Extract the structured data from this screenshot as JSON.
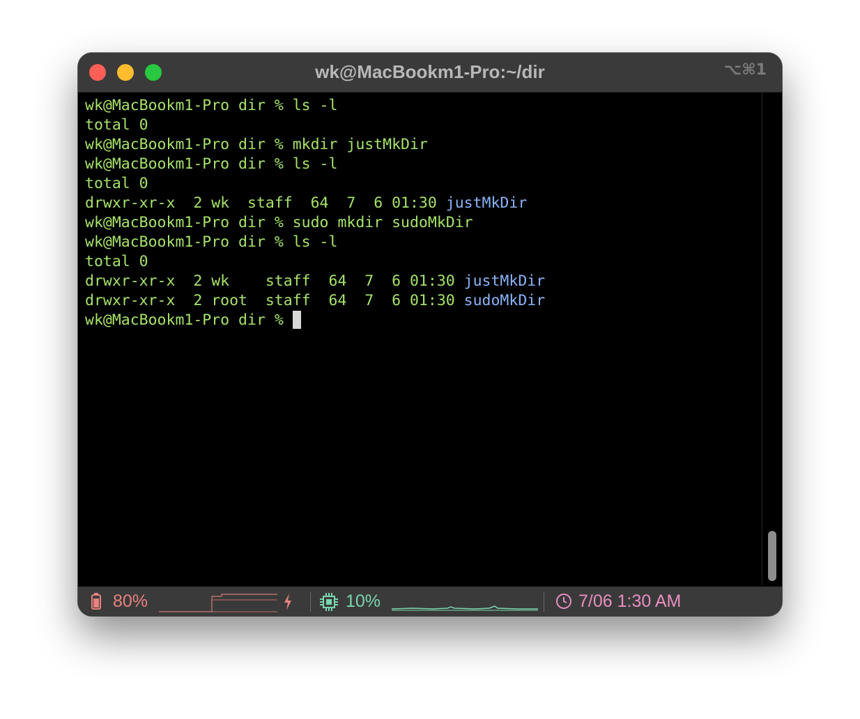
{
  "window": {
    "title": "wk@MacBookm1-Pro:~/dir",
    "shortcut": "⌥⌘1"
  },
  "terminal": {
    "lines": [
      {
        "prompt": "wk@MacBookm1-Pro dir % ",
        "command": "ls -l"
      },
      {
        "text": "total 0"
      },
      {
        "prompt": "wk@MacBookm1-Pro dir % ",
        "command": "mkdir justMkDir"
      },
      {
        "prompt": "wk@MacBookm1-Pro dir % ",
        "command": "ls -l"
      },
      {
        "text": "total 0"
      },
      {
        "listing": "drwxr-xr-x  2 wk  staff  64  7  6 01:30 ",
        "name": "justMkDir"
      },
      {
        "prompt": "wk@MacBookm1-Pro dir % ",
        "command": "sudo mkdir sudoMkDir"
      },
      {
        "prompt": "wk@MacBookm1-Pro dir % ",
        "command": "ls -l"
      },
      {
        "text": "total 0"
      },
      {
        "listing": "drwxr-xr-x  2 wk    staff  64  7  6 01:30 ",
        "name": "justMkDir"
      },
      {
        "listing": "drwxr-xr-x  2 root  staff  64  7  6 01:30 ",
        "name": "sudoMkDir"
      },
      {
        "prompt": "wk@MacBookm1-Pro dir % ",
        "command": ""
      }
    ]
  },
  "statusbar": {
    "battery": {
      "icon": "battery-icon",
      "value": "80%",
      "color": "#e8827f"
    },
    "charging_icon": "bolt-icon",
    "cpu": {
      "icon": "cpu-chip-icon",
      "value": "10%",
      "color": "#7ad6b0"
    },
    "clock": {
      "icon": "clock-icon",
      "value": "7/06 1:30 AM",
      "color": "#e98fbf"
    }
  },
  "colors": {
    "text": "#a6e36a",
    "directory": "#8ab4f8",
    "titlebar": "#3a3a3a"
  }
}
